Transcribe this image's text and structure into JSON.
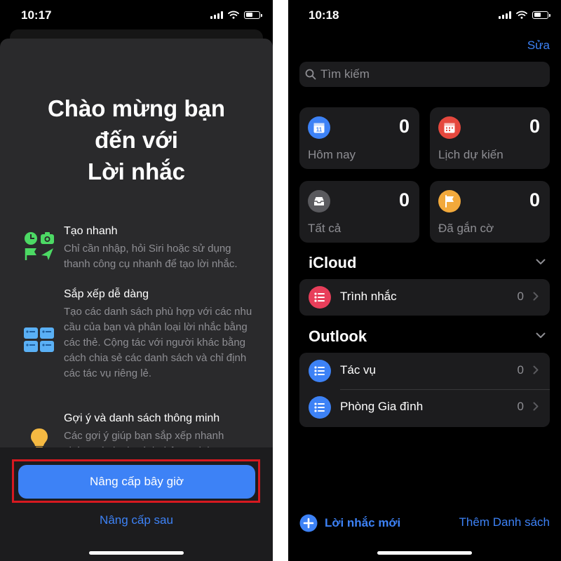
{
  "left": {
    "status": {
      "time": "10:17"
    },
    "title_lines": [
      "Chào mừng bạn",
      "đến với",
      "Lời nhắc"
    ],
    "features": [
      {
        "title": "Tạo nhanh",
        "desc": "Chỉ cần nhập, hỏi Siri hoặc sử dụng thanh công cụ nhanh để tạo lời nhắc."
      },
      {
        "title": "Sắp xếp dễ dàng",
        "desc": "Tạo các danh sách phù hợp với các nhu cầu của bạn và phân loại lời nhắc bằng các thẻ. Cộng tác với người khác bằng cách chia sẻ các danh sách và chỉ định các tác vụ riêng lẻ."
      },
      {
        "title": "Gợi ý và danh sách thông minh",
        "desc": "Các gợi ý giúp bạn sắp xếp nhanh chóng và danh sách thông minh tự"
      }
    ],
    "upgrade_now": "Nâng cấp bây giờ",
    "upgrade_later": "Nâng cấp sau",
    "highlight_color": "#d71920"
  },
  "right": {
    "status": {
      "time": "10:18"
    },
    "edit": "Sửa",
    "search_placeholder": "Tìm kiếm",
    "cards": [
      {
        "label": "Hôm nay",
        "count": "0",
        "icon": "calendar-today-icon",
        "color": "#3d82f6"
      },
      {
        "label": "Lịch dự kiến",
        "count": "0",
        "icon": "calendar-scheduled-icon",
        "color": "#e5483e"
      },
      {
        "label": "Tất cả",
        "count": "0",
        "icon": "tray-icon",
        "color": "#5a5a5e"
      },
      {
        "label": "Đã gắn cờ",
        "count": "0",
        "icon": "flag-icon",
        "color": "#f2a93b"
      }
    ],
    "groups": [
      {
        "name": "iCloud",
        "lists": [
          {
            "name": "Trình nhắc",
            "count": "0",
            "color": "#e83e5a"
          }
        ]
      },
      {
        "name": "Outlook",
        "lists": [
          {
            "name": "Tác vụ",
            "count": "0",
            "color": "#3d82f6"
          },
          {
            "name": "Phòng Gia đình",
            "count": "0",
            "color": "#3d82f6"
          }
        ]
      }
    ],
    "new_reminder": "Lời nhắc mới",
    "add_list": "Thêm Danh sách",
    "accent_color": "#3d82f6"
  }
}
